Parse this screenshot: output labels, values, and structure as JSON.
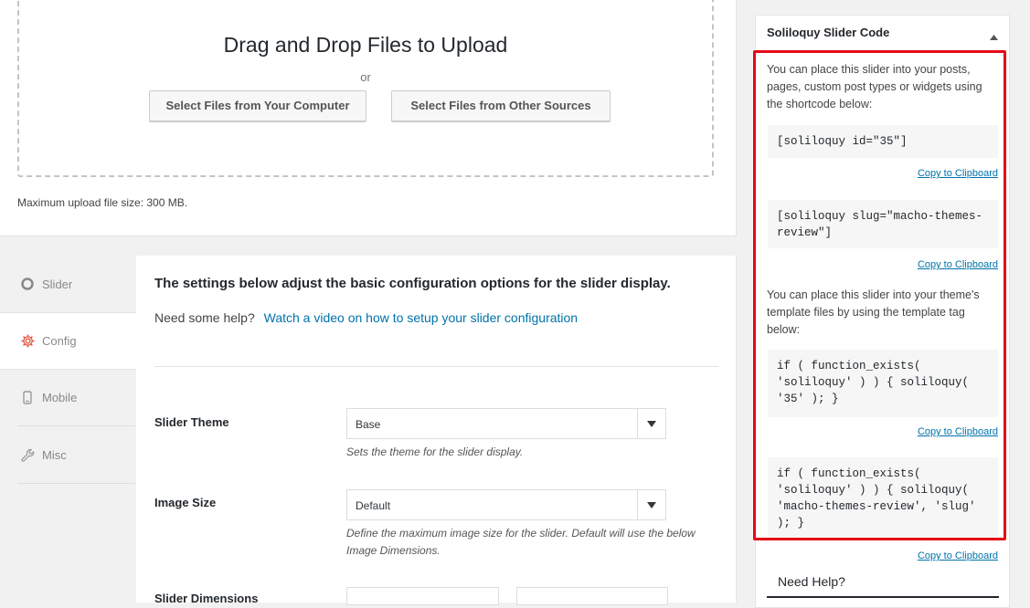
{
  "upload": {
    "title": "Drag and Drop Files to Upload",
    "or": "or",
    "select_computer": "Select Files from Your Computer",
    "select_other": "Select Files from Other Sources",
    "max_size": "Maximum upload file size: 300 MB."
  },
  "tabs": [
    {
      "label": "Slider",
      "icon": "circle-icon"
    },
    {
      "label": "Config",
      "icon": "gear-icon"
    },
    {
      "label": "Mobile",
      "icon": "mobile-icon"
    },
    {
      "label": "Misc",
      "icon": "wrench-icon"
    }
  ],
  "settings": {
    "heading": "The settings below adjust the basic configuration options for the slider display.",
    "help_prefix": "Need some help?",
    "help_link": "Watch a video on how to setup your slider configuration",
    "slider_theme_label": "Slider Theme",
    "slider_theme_value": "Base",
    "slider_theme_desc": "Sets the theme for the slider display.",
    "image_size_label": "Image Size",
    "image_size_value": "Default",
    "image_size_desc": "Define the maximum image size for the slider. Default will use the below Image Dimensions.",
    "dimensions_label": "Slider Dimensions"
  },
  "metabox": {
    "title": "Soliloquy Slider Code",
    "intro": "You can place this slider into your posts, pages, custom post types or widgets using the shortcode below:",
    "code1": "[soliloquy id=\"35\"]",
    "code2": "[soliloquy slug=\"macho-themes-review\"]",
    "template_intro": "You can place this slider into your theme's template files by using the template tag below:",
    "code3": "if ( function_exists( 'soliloquy' ) ) { soliloquy( '35' ); }",
    "code4": "if ( function_exists( 'soliloquy' ) ) { soliloquy( 'macho-themes-review', 'slug' ); }",
    "copy": "Copy to Clipboard",
    "need_help": "Need Help?"
  },
  "colors": {
    "accent": "#0073aa",
    "highlight": "#e50914"
  }
}
